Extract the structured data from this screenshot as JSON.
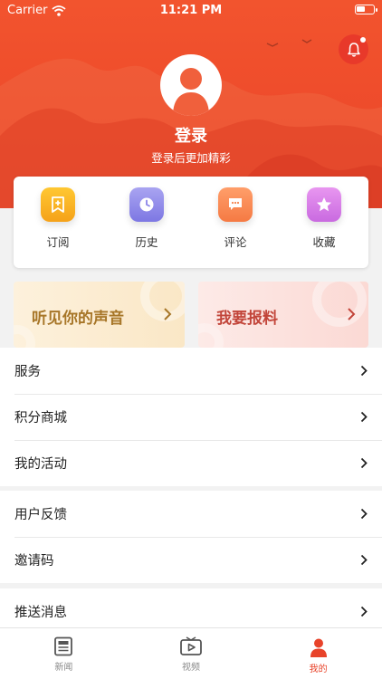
{
  "status_bar": {
    "carrier": "Carrier",
    "time": "11:21 PM"
  },
  "profile": {
    "login_label": "登录",
    "login_subtitle": "登录后更加精彩"
  },
  "quick_actions": [
    {
      "label": "订阅",
      "icon": "bookmark-plus-icon",
      "color_top": "#ffc832",
      "color_bottom": "#f5a219"
    },
    {
      "label": "历史",
      "icon": "clock-icon",
      "color_top": "#a9a4f1",
      "color_bottom": "#7d77e3"
    },
    {
      "label": "评论",
      "icon": "comment-icon",
      "color_top": "#ff9e6a",
      "color_bottom": "#f57a43"
    },
    {
      "label": "收藏",
      "icon": "star-icon",
      "color_top": "#e896f0",
      "color_bottom": "#c96ae0"
    }
  ],
  "banners": {
    "voice": "听见你的声音",
    "report": "我要报料"
  },
  "list_groups": [
    {
      "items": [
        "服务",
        "积分商城",
        "我的活动"
      ]
    },
    {
      "items": [
        "用户反馈",
        "邀请码"
      ]
    },
    {
      "items": [
        "推送消息"
      ]
    }
  ],
  "tabbar": {
    "items": [
      {
        "label": "新闻",
        "icon": "news-icon",
        "active": false
      },
      {
        "label": "视频",
        "icon": "video-icon",
        "active": false
      },
      {
        "label": "我的",
        "icon": "profile-icon",
        "active": true
      }
    ]
  },
  "colors": {
    "brand": "#ee4b2b",
    "active_tab": "#e8432a"
  }
}
